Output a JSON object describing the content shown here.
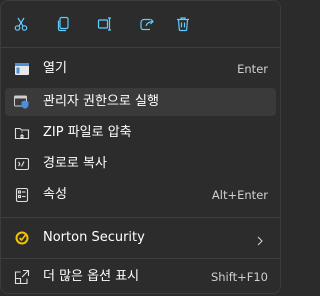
{
  "colors": {
    "icon_blue": "#60cdff",
    "icon_gray": "#e0e0e0",
    "background": "#2c2c2c",
    "hover": "#3a3a3a",
    "norton_yellow": "#f5c400"
  },
  "toolbar": {
    "buttons": [
      {
        "name": "cut",
        "icon": "scissors-icon"
      },
      {
        "name": "copy",
        "icon": "copy-icon"
      },
      {
        "name": "rename",
        "icon": "rename-icon"
      },
      {
        "name": "share",
        "icon": "share-icon"
      },
      {
        "name": "delete",
        "icon": "trash-icon"
      }
    ]
  },
  "items": [
    {
      "label": "열기",
      "shortcut": "Enter",
      "icon": "open-app-icon"
    },
    {
      "label": "관리자 권한으로 실행",
      "shortcut": "",
      "icon": "shield-admin-icon"
    },
    {
      "label": "ZIP 파일로 압축",
      "shortcut": "",
      "icon": "zip-folder-icon"
    },
    {
      "label": "경로로 복사",
      "shortcut": "",
      "icon": "copy-path-icon"
    },
    {
      "label": "속성",
      "shortcut": "Alt+Enter",
      "icon": "properties-icon"
    },
    {
      "label": "Norton Security",
      "shortcut": "",
      "icon": "norton-icon",
      "submenu": true
    },
    {
      "label": "더 많은 옵션 표시",
      "shortcut": "Shift+F10",
      "icon": "more-options-icon"
    }
  ]
}
